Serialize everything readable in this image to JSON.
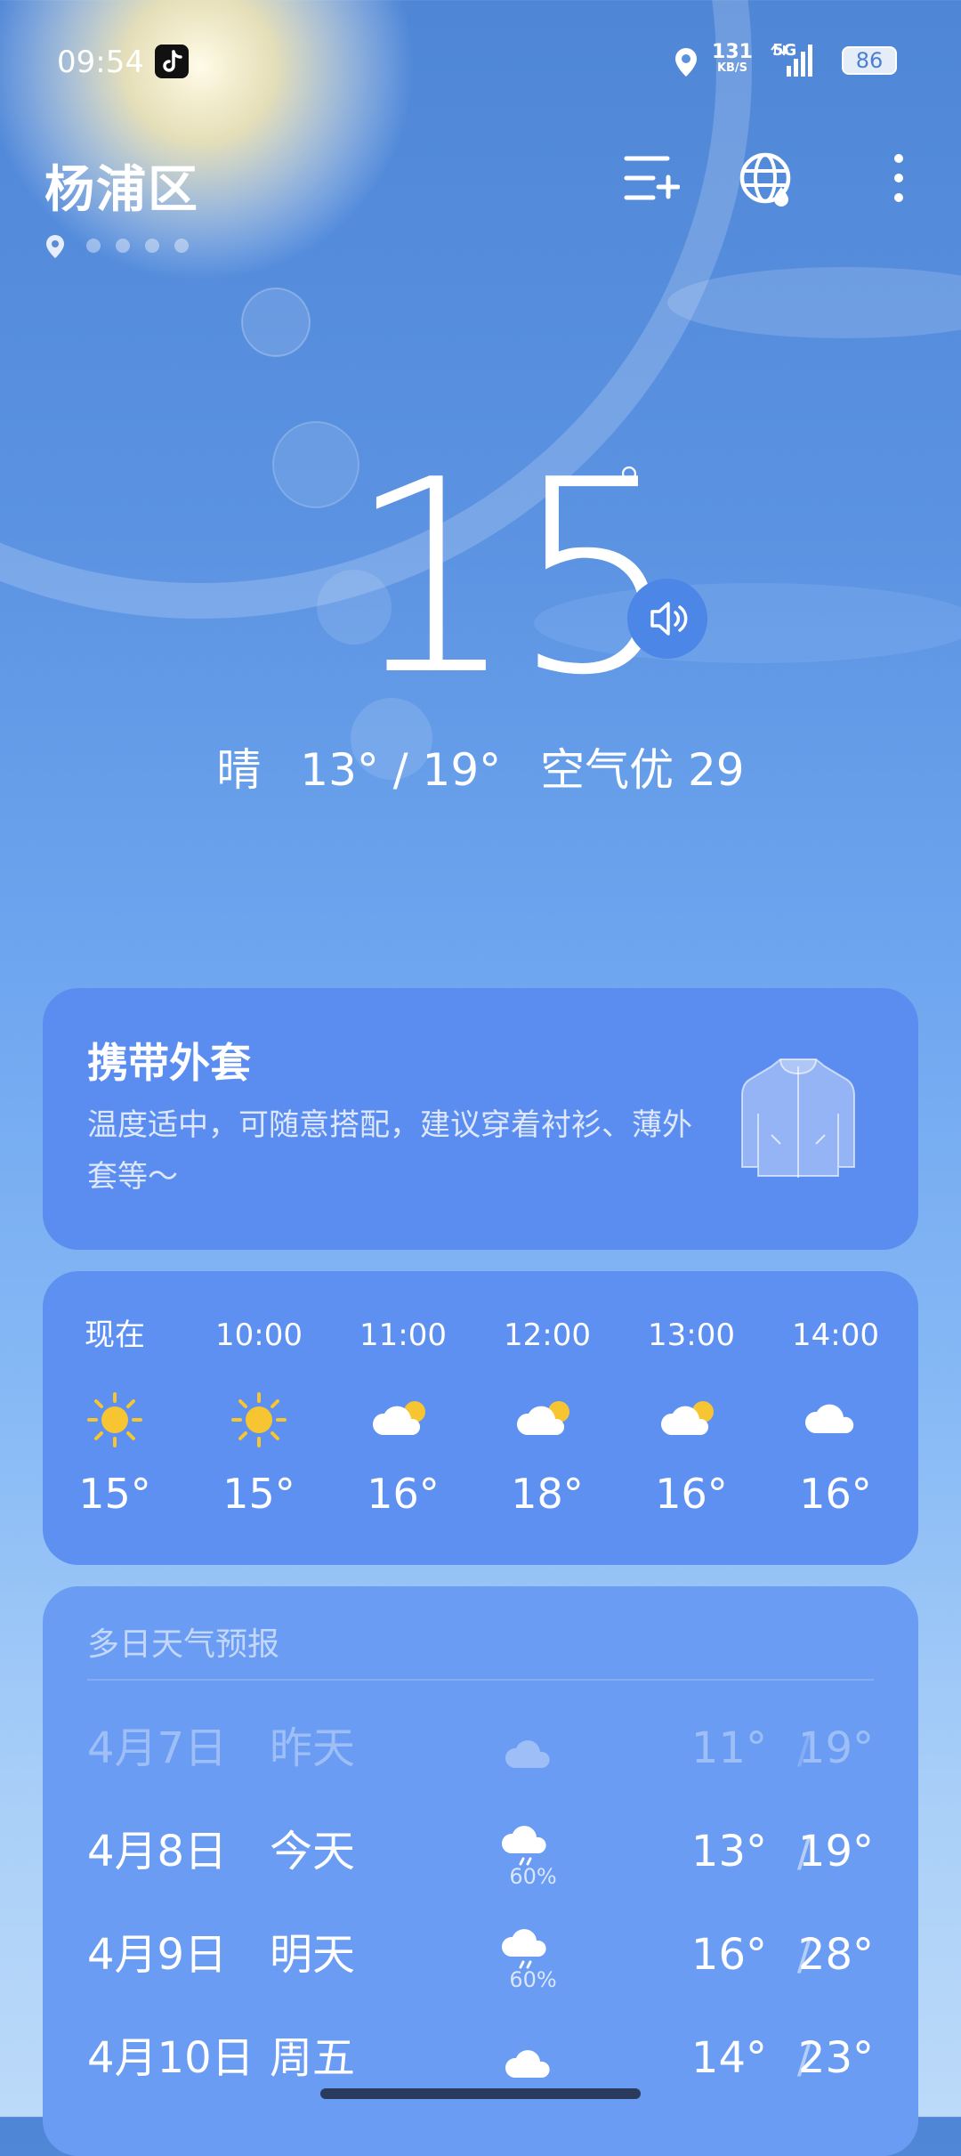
{
  "status_bar": {
    "time": "09:54",
    "net_speed": "131",
    "net_unit": "KB/S",
    "network": "5G",
    "battery": "86"
  },
  "header": {
    "city": "杨浦区"
  },
  "current": {
    "temp": "15",
    "deg": "°",
    "condition": "晴",
    "range": "13° / 19°",
    "air": "空气优 29"
  },
  "advice": {
    "title": "携带外套",
    "text": "温度适中，可随意搭配，建议穿着衬衫、薄外套等～"
  },
  "hourly": [
    {
      "time": "现在",
      "icon": "sun-icon",
      "temp": "15°"
    },
    {
      "time": "10:00",
      "icon": "sun-icon",
      "temp": "15°"
    },
    {
      "time": "11:00",
      "icon": "partly-cloudy-icon",
      "temp": "16°"
    },
    {
      "time": "12:00",
      "icon": "partly-cloudy-icon",
      "temp": "18°"
    },
    {
      "time": "13:00",
      "icon": "partly-cloudy-icon",
      "temp": "16°"
    },
    {
      "time": "14:00",
      "icon": "cloud-icon",
      "temp": "16°"
    }
  ],
  "forecast": {
    "title": "多日天气预报",
    "days": [
      {
        "date": "4月7日",
        "day": "昨天",
        "icon": "cloud-icon",
        "pct": "",
        "lo": "11°",
        "sep": "/",
        "hi": "19°"
      },
      {
        "date": "4月8日",
        "day": "今天",
        "icon": "rain-icon",
        "pct": "60%",
        "lo": "13°",
        "sep": "/",
        "hi": "19°"
      },
      {
        "date": "4月9日",
        "day": "明天",
        "icon": "rain-icon",
        "pct": "60%",
        "lo": "16°",
        "sep": "/",
        "hi": "28°"
      },
      {
        "date": "4月10日",
        "day": "周五",
        "icon": "cloud-icon",
        "pct": "",
        "lo": "14°",
        "sep": "/",
        "hi": "23°"
      }
    ]
  },
  "colors": {
    "sun": "#f7c531",
    "card": "#5b8df0",
    "speaker": "#4c86e6"
  }
}
